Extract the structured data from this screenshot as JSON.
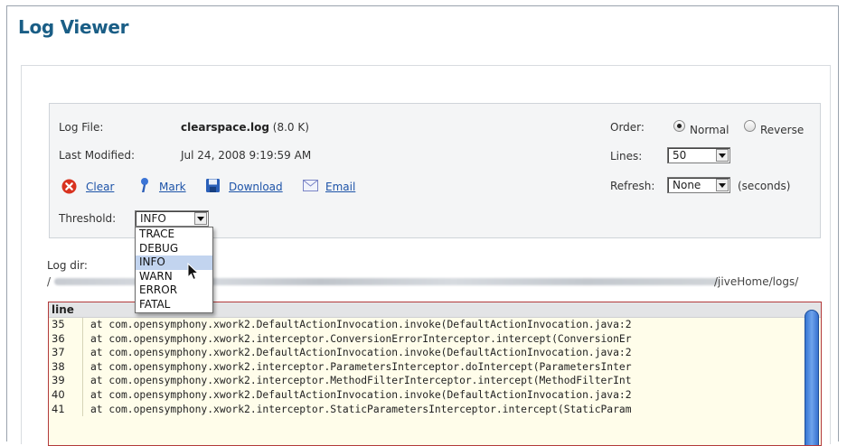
{
  "page": {
    "title": "Log Viewer"
  },
  "log_file": {
    "label": "Log File:",
    "name": "clearspace.log",
    "size": "(8.0 K)"
  },
  "last_modified": {
    "label": "Last Modified:",
    "value": "Jul 24, 2008 9:19:59 AM"
  },
  "actions": [
    {
      "label": "Clear",
      "icon": "clear-icon"
    },
    {
      "label": "Mark",
      "icon": "mark-icon"
    },
    {
      "label": "Download",
      "icon": "download-icon"
    },
    {
      "label": "Email",
      "icon": "email-icon"
    }
  ],
  "threshold": {
    "label": "Threshold:",
    "selected": "INFO",
    "options": [
      "TRACE",
      "DEBUG",
      "INFO",
      "WARN",
      "ERROR",
      "FATAL"
    ]
  },
  "order": {
    "label": "Order:",
    "options": [
      "Normal",
      "Reverse"
    ],
    "selected": "Normal"
  },
  "lines": {
    "label": "Lines:",
    "value": "50"
  },
  "refresh": {
    "label": "Refresh:",
    "value": "None",
    "unit": "(seconds)"
  },
  "log_dir": {
    "label": "Log dir:",
    "path_visible": "/jiveHome/logs/"
  },
  "log_table": {
    "header": "line",
    "rows": [
      {
        "num": "35",
        "text": "at com.opensymphony.xwork2.DefaultActionInvocation.invoke(DefaultActionInvocation.java:2"
      },
      {
        "num": "36",
        "text": "at com.opensymphony.xwork2.interceptor.ConversionErrorInterceptor.intercept(ConversionEr"
      },
      {
        "num": "37",
        "text": "at com.opensymphony.xwork2.DefaultActionInvocation.invoke(DefaultActionInvocation.java:2"
      },
      {
        "num": "38",
        "text": "at com.opensymphony.xwork2.interceptor.ParametersInterceptor.doIntercept(ParametersInter"
      },
      {
        "num": "39",
        "text": "at com.opensymphony.xwork2.interceptor.MethodFilterInterceptor.intercept(MethodFilterInt"
      },
      {
        "num": "40",
        "text": "at com.opensymphony.xwork2.DefaultActionInvocation.invoke(DefaultActionInvocation.java:2"
      },
      {
        "num": "41",
        "text": "at com.opensymphony.xwork2.interceptor.StaticParametersInterceptor.intercept(StaticParam"
      }
    ]
  },
  "colors": {
    "title": "#1a5e86",
    "link": "#1d53a8",
    "log_bg": "#fffdea",
    "log_border": "#b33a3a"
  }
}
